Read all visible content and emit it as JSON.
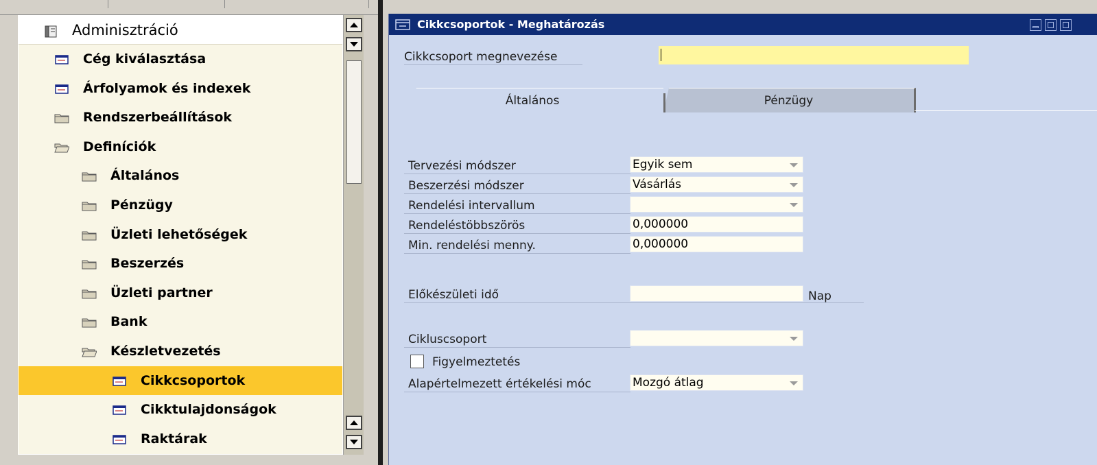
{
  "nav": {
    "items": [
      {
        "label": "Adminisztráció",
        "icon": "binder-icon",
        "level": 0
      },
      {
        "label": "Cég kiválasztása",
        "icon": "window-icon",
        "level": 1
      },
      {
        "label": "Árfolyamok és indexek",
        "icon": "window-icon",
        "level": 1
      },
      {
        "label": "Rendszerbeállítások",
        "icon": "folder-closed-icon",
        "level": 1
      },
      {
        "label": "Definíciók",
        "icon": "folder-open-icon",
        "level": 1
      },
      {
        "label": "Általános",
        "icon": "folder-closed-icon",
        "level": 2
      },
      {
        "label": "Pénzügy",
        "icon": "folder-closed-icon",
        "level": 2
      },
      {
        "label": "Üzleti lehetőségek",
        "icon": "folder-closed-icon",
        "level": 2
      },
      {
        "label": "Beszerzés",
        "icon": "folder-closed-icon",
        "level": 2
      },
      {
        "label": "Üzleti partner",
        "icon": "folder-closed-icon",
        "level": 2
      },
      {
        "label": "Bank",
        "icon": "folder-closed-icon",
        "level": 2
      },
      {
        "label": "Készletvezetés",
        "icon": "folder-open-icon",
        "level": 2
      },
      {
        "label": "Cikkcsoportok",
        "icon": "window-icon",
        "level": 3,
        "selected": true
      },
      {
        "label": "Cikktulajdonságok",
        "icon": "window-icon",
        "level": 3
      },
      {
        "label": "Raktárak",
        "icon": "window-icon",
        "level": 3
      }
    ]
  },
  "window": {
    "title": "Cikkcsoportok - Meghatározás",
    "name_label": "Cikkcsoport megnevezése",
    "name_value": ""
  },
  "tabs": [
    {
      "label": "Általános",
      "active": true
    },
    {
      "label": "Pénzügy",
      "active": false
    }
  ],
  "form": {
    "planning_method_label": "Tervezési módszer",
    "planning_method_value": "Egyik sem",
    "procurement_method_label": "Beszerzési módszer",
    "procurement_method_value": "Vásárlás",
    "order_interval_label": "Rendelési intervallum",
    "order_interval_value": "",
    "order_multiple_label": "Rendeléstöbbszörös",
    "order_multiple_value": "0,000000",
    "min_order_qty_label": "Min. rendelési menny.",
    "min_order_qty_value": "0,000000",
    "lead_time_label": "Előkészületi idő",
    "lead_time_value": "",
    "lead_time_unit": "Nap",
    "cycle_group_label": "Cikluscsoport",
    "cycle_group_value": "",
    "alert_label": "Figyelmeztetés",
    "alert_checked": false,
    "valuation_method_label": "Alapértelmezett értékelési móc",
    "valuation_method_value": "Mozgó átlag"
  },
  "colors": {
    "selected_row": "#fbc72c",
    "titlebar": "#0f2c75",
    "window_bg": "#cdd8ee",
    "name_field": "#fff79f"
  }
}
